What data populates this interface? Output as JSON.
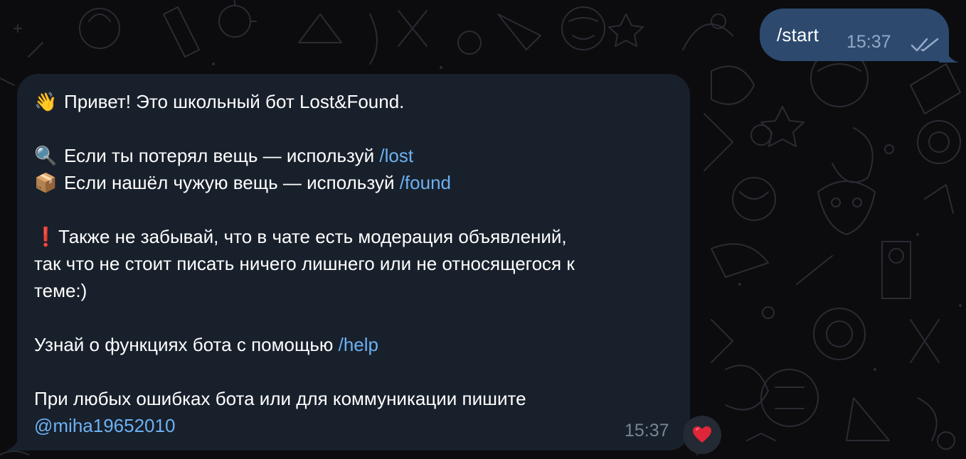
{
  "outgoing": {
    "text": "/start",
    "time": "15:37",
    "status_icon": "double-check-icon"
  },
  "incoming": {
    "greeting_emoji": "👋",
    "greeting": "Привет! Это школьный бот Lost&Found.",
    "lost_emoji": "🔍",
    "lost_text": "Если ты потерял вещь — используй ",
    "lost_command": "/lost",
    "found_emoji": "📦",
    "found_text": "Если нашёл чужую вещь — используй ",
    "found_command": "/found",
    "warning_emoji": "❗",
    "warning_line1": "Также не забывай, что в чате есть модерация объявлений,",
    "warning_line2": "так что не стоит писать ничего лишнего или не относящегося к",
    "warning_line3": "теме:)",
    "help_text": "Узнай о функциях бота с помощью ",
    "help_command": "/help",
    "contact_text": "При любых ошибках бота или для коммуникации пишите",
    "contact_handle": "@miha19652010",
    "time": "15:37",
    "reaction": "❤️"
  },
  "colors": {
    "outgoing_bubble": "#2d4a6e",
    "incoming_bubble": "#18202b",
    "link": "#6cb1f2",
    "reaction_heart": "#e0263a"
  }
}
